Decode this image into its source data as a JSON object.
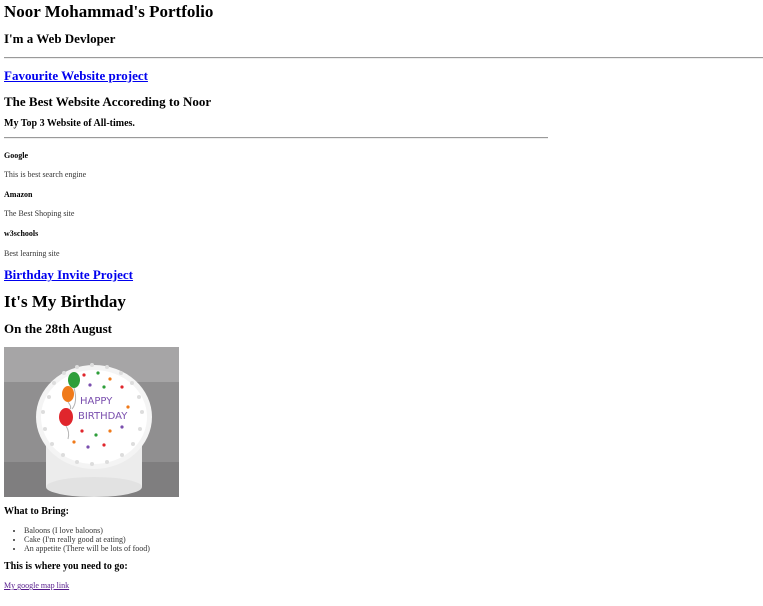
{
  "portfolio": {
    "title": "Noor Mohammad's Portfolio",
    "subtitle": "I'm a Web Devloper"
  },
  "favourite": {
    "link_label": "Favourite Website project",
    "heading": "The Best Website Accoreding to Noor",
    "subheading": "My Top 3 Website of All-times.",
    "sites": [
      {
        "name": "Google",
        "desc": "This is best search engine"
      },
      {
        "name": "Amazon",
        "desc": "The Best Shoping site"
      },
      {
        "name": "w3schools",
        "desc": "Best learning site"
      }
    ]
  },
  "birthday": {
    "link_label": "Birthday Invite Project",
    "heading": "It's My Birthday",
    "date": "On the 28th August",
    "cake_text": [
      "HAPPY",
      "BIRTHDAY"
    ],
    "bring_heading": "What to Bring:",
    "bring_items": [
      "Baloons (I love baloons)",
      "Cake (I'm really good at eating)",
      "An appetite (There will be lots of food)"
    ],
    "where_heading": "This is where you need to go:",
    "map_link": "My google map link"
  }
}
